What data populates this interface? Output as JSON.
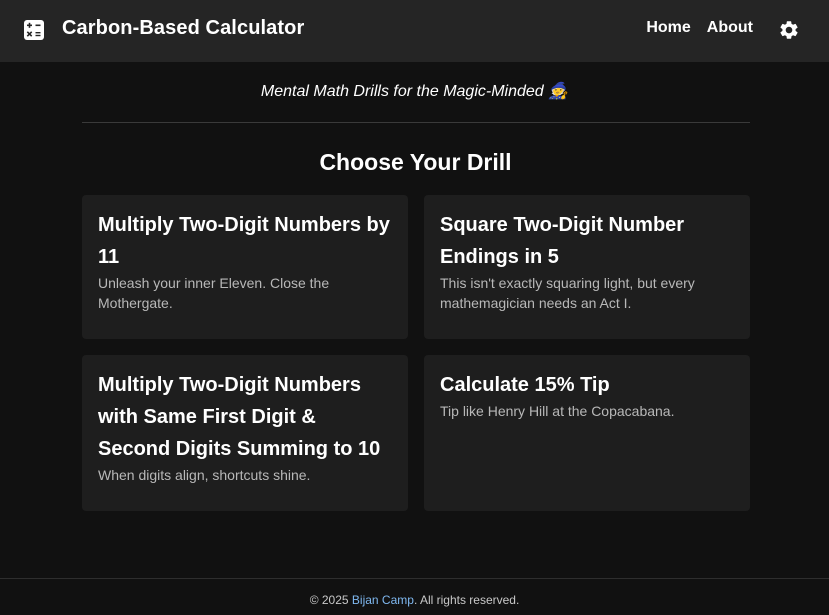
{
  "header": {
    "title": "Carbon-Based Calculator",
    "logo_icon": "calculator-icon",
    "nav": [
      {
        "label": "Home"
      },
      {
        "label": "About"
      }
    ],
    "settings_icon": "gear-icon"
  },
  "tagline": "Mental Math Drills for the Magic-Minded 🧙",
  "section_title": "Choose Your Drill",
  "drills": [
    {
      "title": "Multiply Two-Digit Numbers by 11",
      "description": "Unleash your inner Eleven. Close the Mothergate."
    },
    {
      "title": "Square Two-Digit Number Endings in 5",
      "description": "This isn't exactly squaring light, but every mathemagician needs an Act I."
    },
    {
      "title": "Multiply Two-Digit Numbers with Same First Digit & Second Digits Summing to 10",
      "description": "When digits align, shortcuts shine."
    },
    {
      "title": "Calculate 15% Tip",
      "description": "Tip like Henry Hill at the Copacabana."
    }
  ],
  "footer": {
    "prefix": "© 2025 ",
    "link_text": "Bijan Camp",
    "suffix": ". All rights reserved."
  },
  "colors": {
    "background": "#111111",
    "header": "#252525",
    "card": "#1e1e1e",
    "link": "#7fb8f0"
  }
}
